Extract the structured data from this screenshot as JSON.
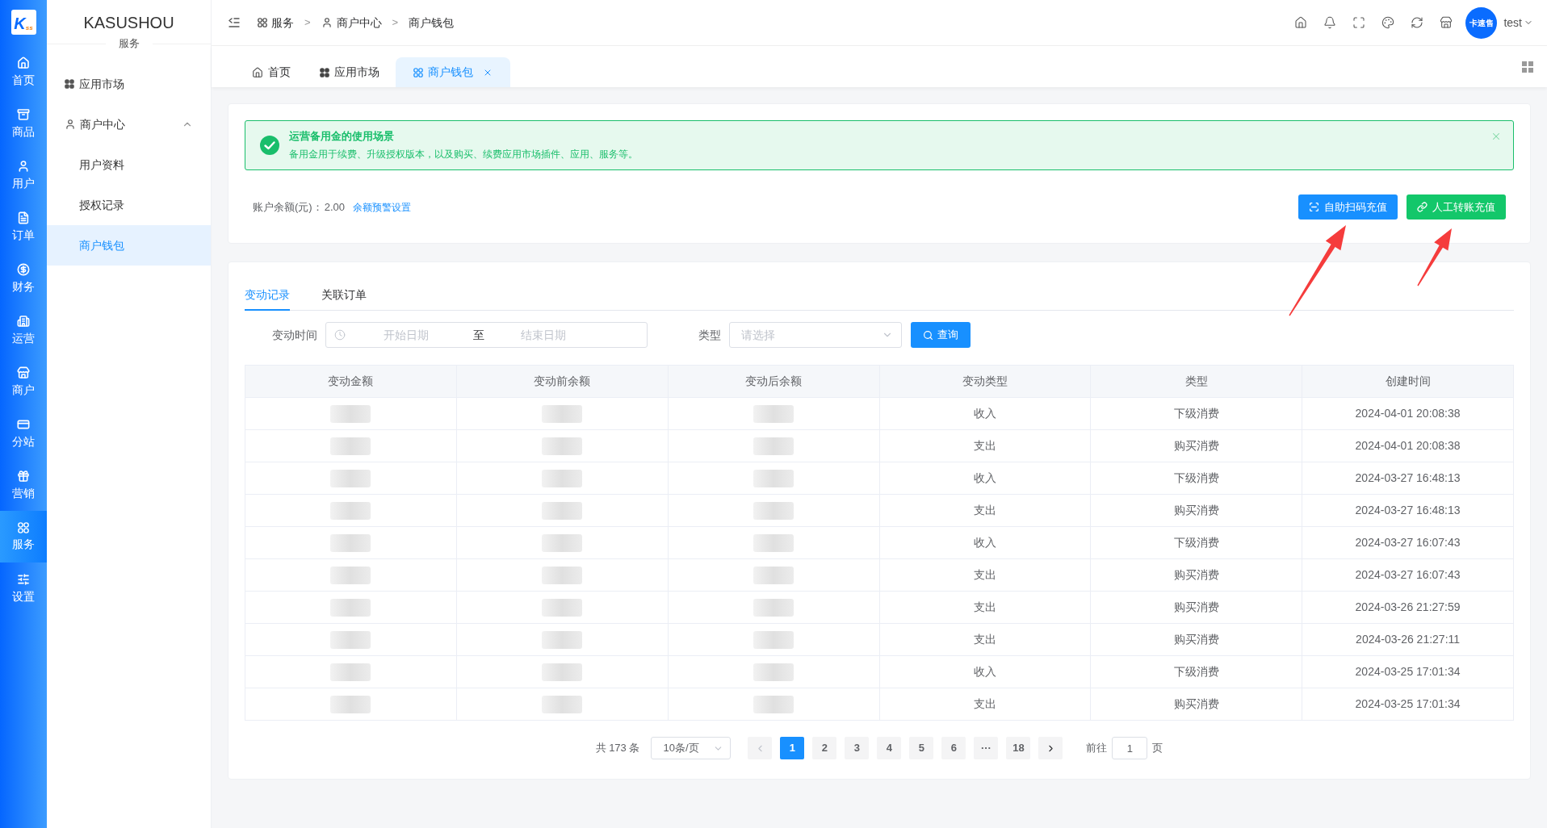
{
  "rail": {
    "logo": {
      "main": "K",
      "small": "ss"
    },
    "items": [
      {
        "label": "首页",
        "selected": false
      },
      {
        "label": "商品",
        "selected": false
      },
      {
        "label": "用户",
        "selected": false
      },
      {
        "label": "订单",
        "selected": false
      },
      {
        "label": "财务",
        "selected": false
      },
      {
        "label": "运营",
        "selected": false
      },
      {
        "label": "商户",
        "selected": false
      },
      {
        "label": "分站",
        "selected": false
      },
      {
        "label": "营销",
        "selected": false
      },
      {
        "label": "服务",
        "selected": true
      },
      {
        "label": "设置",
        "selected": false
      }
    ]
  },
  "sidebar": {
    "brand": "KASUSHOU",
    "section": "服务",
    "items": [
      {
        "label": "应用市场",
        "selected": false
      },
      {
        "label": "商户中心",
        "selected": false,
        "expanded": true,
        "children": [
          {
            "label": "用户资料",
            "selected": false
          },
          {
            "label": "授权记录",
            "selected": false
          },
          {
            "label": "商户钱包",
            "selected": true
          }
        ]
      }
    ]
  },
  "header": {
    "breadcrumb": [
      {
        "label": "服务"
      },
      {
        "label": "商户中心",
        "separator": ">"
      },
      {
        "label": "商户钱包",
        "separator": ">"
      }
    ],
    "user": {
      "avatar_text": "卡速售",
      "name": "test"
    }
  },
  "page_tabs": [
    {
      "label": "首页",
      "selected": false,
      "closable": false
    },
    {
      "label": "应用市场",
      "selected": false,
      "closable": false
    },
    {
      "label": "商户钱包",
      "selected": true,
      "closable": true
    }
  ],
  "alert": {
    "kind": "success",
    "title": "运营备用金的使用场景",
    "description": "备用金用于续费、升级授权版本，以及购买、续费应用市场插件、应用、服务等。",
    "closable": true
  },
  "balance": {
    "label": "账户余额(元)：",
    "value": "2.00",
    "link": "余额预警设置"
  },
  "actions": [
    {
      "label": "自助扫码充值",
      "kind": "primary",
      "arrow": true
    },
    {
      "label": "人工转账充值",
      "kind": "success",
      "arrow": true
    }
  ],
  "records": {
    "tabs": [
      {
        "label": "变动记录",
        "selected": true
      },
      {
        "label": "关联订单",
        "selected": false
      }
    ],
    "filters": {
      "time_label": "变动时间",
      "start_placeholder": "开始日期",
      "range_separator": "至",
      "end_placeholder": "结束日期",
      "type_label": "类型",
      "type_placeholder": "请选择",
      "search_button": "查询"
    },
    "table": {
      "columns": [
        "变动金额",
        "变动前余额",
        "变动后余额",
        "变动类型",
        "类型",
        "创建时间"
      ],
      "rows": [
        {
          "cells": [
            {
              "kind": "blurred"
            },
            {
              "kind": "blurred"
            },
            {
              "kind": "blurred"
            },
            {
              "kind": "text",
              "text": "收入"
            },
            {
              "kind": "text",
              "text": "下级消费"
            },
            {
              "kind": "text",
              "text": "2024-04-01 20:08:38"
            }
          ]
        },
        {
          "cells": [
            {
              "kind": "blurred"
            },
            {
              "kind": "blurred"
            },
            {
              "kind": "blurred"
            },
            {
              "kind": "text",
              "text": "支出"
            },
            {
              "kind": "text",
              "text": "购买消费"
            },
            {
              "kind": "text",
              "text": "2024-04-01 20:08:38"
            }
          ]
        },
        {
          "cells": [
            {
              "kind": "blurred"
            },
            {
              "kind": "blurred"
            },
            {
              "kind": "blurred"
            },
            {
              "kind": "text",
              "text": "收入"
            },
            {
              "kind": "text",
              "text": "下级消费"
            },
            {
              "kind": "text",
              "text": "2024-03-27 16:48:13"
            }
          ]
        },
        {
          "cells": [
            {
              "kind": "blurred"
            },
            {
              "kind": "blurred"
            },
            {
              "kind": "blurred"
            },
            {
              "kind": "text",
              "text": "支出"
            },
            {
              "kind": "text",
              "text": "购买消费"
            },
            {
              "kind": "text",
              "text": "2024-03-27 16:48:13"
            }
          ]
        },
        {
          "cells": [
            {
              "kind": "blurred"
            },
            {
              "kind": "blurred"
            },
            {
              "kind": "blurred"
            },
            {
              "kind": "text",
              "text": "收入"
            },
            {
              "kind": "text",
              "text": "下级消费"
            },
            {
              "kind": "text",
              "text": "2024-03-27 16:07:43"
            }
          ]
        },
        {
          "cells": [
            {
              "kind": "blurred"
            },
            {
              "kind": "blurred"
            },
            {
              "kind": "blurred"
            },
            {
              "kind": "text",
              "text": "支出"
            },
            {
              "kind": "text",
              "text": "购买消费"
            },
            {
              "kind": "text",
              "text": "2024-03-27 16:07:43"
            }
          ]
        },
        {
          "cells": [
            {
              "kind": "blurred"
            },
            {
              "kind": "blurred"
            },
            {
              "kind": "blurred"
            },
            {
              "kind": "text",
              "text": "支出"
            },
            {
              "kind": "text",
              "text": "购买消费"
            },
            {
              "kind": "text",
              "text": "2024-03-26 21:27:59"
            }
          ]
        },
        {
          "cells": [
            {
              "kind": "blurred"
            },
            {
              "kind": "blurred"
            },
            {
              "kind": "blurred"
            },
            {
              "kind": "text",
              "text": "支出"
            },
            {
              "kind": "text",
              "text": "购买消费"
            },
            {
              "kind": "text",
              "text": "2024-03-26 21:27:11"
            }
          ]
        },
        {
          "cells": [
            {
              "kind": "blurred"
            },
            {
              "kind": "blurred"
            },
            {
              "kind": "blurred"
            },
            {
              "kind": "text",
              "text": "收入"
            },
            {
              "kind": "text",
              "text": "下级消费"
            },
            {
              "kind": "text",
              "text": "2024-03-25 17:01:34"
            }
          ]
        },
        {
          "cells": [
            {
              "kind": "blurred"
            },
            {
              "kind": "blurred"
            },
            {
              "kind": "blurred"
            },
            {
              "kind": "text",
              "text": "支出"
            },
            {
              "kind": "text",
              "text": "购买消费"
            },
            {
              "kind": "text",
              "text": "2024-03-25 17:01:34"
            }
          ]
        }
      ]
    },
    "pagination": {
      "total": "共 173 条",
      "page_size": "10条/页",
      "prev": {
        "disabled": true
      },
      "pages": [
        {
          "label": "1",
          "selected": true
        },
        {
          "label": "2",
          "selected": false
        },
        {
          "label": "3",
          "selected": false
        },
        {
          "label": "4",
          "selected": false
        },
        {
          "label": "5",
          "selected": false
        },
        {
          "label": "6",
          "selected": false
        },
        {
          "label": "···",
          "selected": false
        },
        {
          "label": "18",
          "selected": false
        }
      ],
      "next": {
        "disabled": false
      },
      "goto_label": "前往",
      "goto_value": "1",
      "goto_suffix": "页"
    }
  }
}
